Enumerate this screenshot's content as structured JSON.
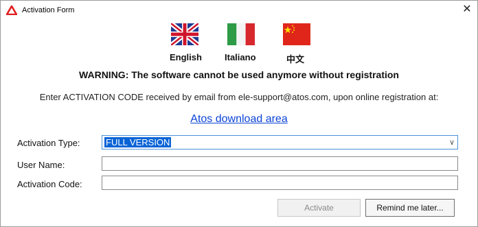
{
  "window": {
    "title": "Activation Form",
    "close_symbol": "✕",
    "icon": "atos-triangle-icon"
  },
  "languages": [
    {
      "label": "English",
      "flag": "uk-flag-icon"
    },
    {
      "label": "Italiano",
      "flag": "italy-flag-icon"
    },
    {
      "label": "中文",
      "flag": "china-flag-icon"
    }
  ],
  "messages": {
    "warning": "WARNING: The software cannot be used anymore without registration",
    "info": "Enter ACTIVATION CODE received by email from ele-support@atos.com, upon online registration at:",
    "link": "Atos download area"
  },
  "form": {
    "activation_type_label": "Activation Type:",
    "activation_type_value": "FULL VERSION",
    "user_name_label": "User Name:",
    "user_name_value": "",
    "activation_code_label": "Activation Code:",
    "activation_code_value": ""
  },
  "buttons": {
    "activate": "Activate",
    "remind": "Remind me later..."
  },
  "colors": {
    "accent": "#0a64d6",
    "link": "#0a43d6",
    "icon_red": "#e02020"
  }
}
